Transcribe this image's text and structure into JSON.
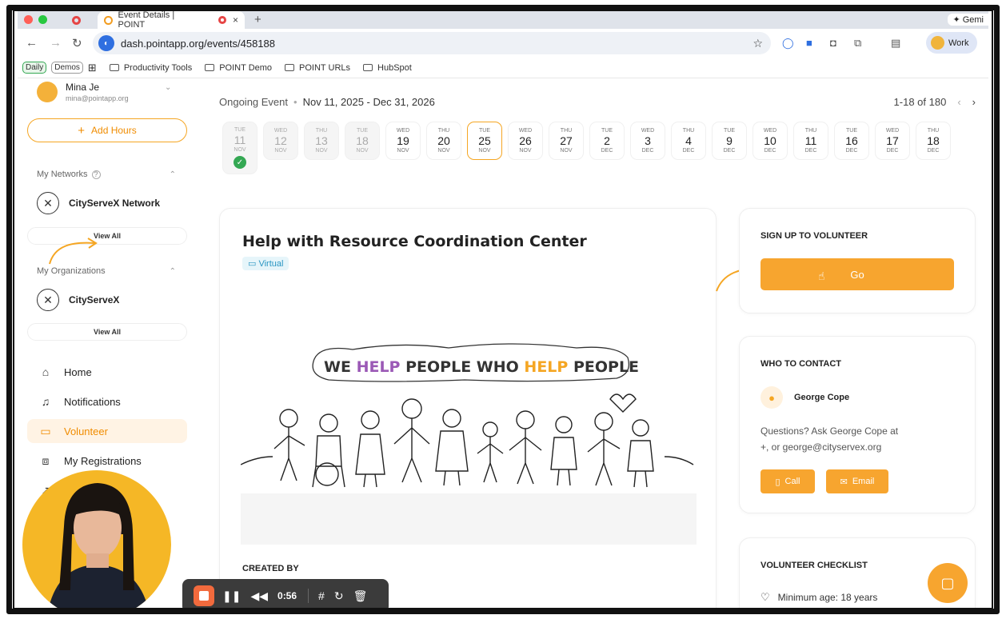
{
  "browser": {
    "tab_title": "Event Details | POINT",
    "gemini_label": "✦ Gemi",
    "url": "dash.pointapp.org/events/458188",
    "profile_label": "Work"
  },
  "bookmarks": [
    {
      "label": "Daily",
      "kind": "pill"
    },
    {
      "label": "Demos",
      "kind": "pill"
    },
    {
      "label": "Productivity Tools",
      "kind": "folder"
    },
    {
      "label": "POINT Demo",
      "kind": "folder"
    },
    {
      "label": "POINT URLs",
      "kind": "folder"
    },
    {
      "label": "HubSpot",
      "kind": "folder"
    }
  ],
  "user": {
    "name": "Mina Je",
    "email": "mina@pointapp.org"
  },
  "sidebar": {
    "add_hours": "Add Hours",
    "networks_title": "My Networks",
    "network_name": "CityServeX Network",
    "view_all": "View All",
    "orgs_title": "My Organizations",
    "org_name": "CityServeX",
    "nav": [
      {
        "label": "Home",
        "icon": "home-icon"
      },
      {
        "label": "Notifications",
        "icon": "bell-icon"
      },
      {
        "label": "Volunteer",
        "icon": "calendar-icon",
        "active": true
      },
      {
        "label": "My Registrations",
        "icon": "ticket-icon"
      }
    ]
  },
  "event": {
    "status": "Ongoing Event",
    "range": "Nov 11, 2025 - Dec 31, 2026",
    "pager": "1-18 of 180",
    "title": "Help with Resource Coordination Center",
    "tag": "Virtual",
    "banner_text_1": "WE ",
    "banner_text_2": "HELP",
    "banner_text_3": " PEOPLE WHO ",
    "banner_text_4": "HELP",
    "banner_text_5": " PEOPLE",
    "created_by": "CREATED BY"
  },
  "dates": [
    {
      "dow": "TUE",
      "day": "11",
      "mon": "NOV",
      "state": "past",
      "checked": true
    },
    {
      "dow": "WED",
      "day": "12",
      "mon": "NOV",
      "state": "past"
    },
    {
      "dow": "THU",
      "day": "13",
      "mon": "NOV",
      "state": "past"
    },
    {
      "dow": "TUE",
      "day": "18",
      "mon": "NOV",
      "state": "past"
    },
    {
      "dow": "WED",
      "day": "19",
      "mon": "NOV",
      "state": "normal"
    },
    {
      "dow": "THU",
      "day": "20",
      "mon": "NOV",
      "state": "normal"
    },
    {
      "dow": "TUE",
      "day": "25",
      "mon": "NOV",
      "state": "selected"
    },
    {
      "dow": "WED",
      "day": "26",
      "mon": "NOV",
      "state": "normal"
    },
    {
      "dow": "THU",
      "day": "27",
      "mon": "NOV",
      "state": "normal"
    },
    {
      "dow": "TUE",
      "day": "2",
      "mon": "DEC",
      "state": "normal"
    },
    {
      "dow": "WED",
      "day": "3",
      "mon": "DEC",
      "state": "normal"
    },
    {
      "dow": "THU",
      "day": "4",
      "mon": "DEC",
      "state": "normal"
    },
    {
      "dow": "TUE",
      "day": "9",
      "mon": "DEC",
      "state": "normal"
    },
    {
      "dow": "WED",
      "day": "10",
      "mon": "DEC",
      "state": "normal"
    },
    {
      "dow": "THU",
      "day": "11",
      "mon": "DEC",
      "state": "normal"
    },
    {
      "dow": "TUE",
      "day": "16",
      "mon": "DEC",
      "state": "normal"
    },
    {
      "dow": "WED",
      "day": "17",
      "mon": "DEC",
      "state": "normal"
    },
    {
      "dow": "THU",
      "day": "18",
      "mon": "DEC",
      "state": "normal"
    }
  ],
  "signup": {
    "title": "SIGN UP TO VOLUNTEER",
    "go": "Go"
  },
  "contact": {
    "title": "WHO TO CONTACT",
    "name": "George Cope",
    "question_line1": "Questions? Ask George Cope at",
    "question_line2": "+, or george@cityservex.org",
    "call": "Call",
    "email": "Email"
  },
  "checklist": {
    "title": "VOLUNTEER CHECKLIST",
    "item": "Minimum age: 18 years"
  },
  "recorder": {
    "time": "0:56"
  },
  "colors": {
    "accent": "#f7a52f",
    "accent_text": "#f08c00",
    "virtual": "#2a96c2",
    "success": "#34a853",
    "help_purple": "#9b59b6",
    "help_orange": "#f5a623"
  }
}
